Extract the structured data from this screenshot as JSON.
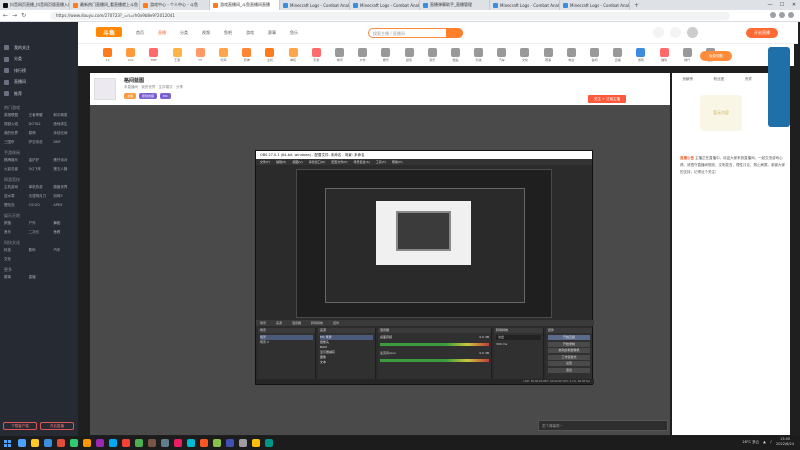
{
  "browser": {
    "tabs": [
      {
        "label": "抖音网页直播_抖音网页版直播入口",
        "icon_color": "#111111",
        "active": false
      },
      {
        "label": "最新热门直播间_看直播就上斗鱼",
        "icon_color": "#ff7a1a",
        "active": false
      },
      {
        "label": "游戏中心 - 个人中心 - 斗鱼",
        "icon_color": "#ff7a1a",
        "active": false
      },
      {
        "label": "游戏直播间_斗鱼直播间直播",
        "icon_color": "#ff7a1a",
        "active": true
      },
      {
        "label": "Minecraft Logs - Combat Analysis",
        "icon_color": "#3c8dde",
        "active": false
      },
      {
        "label": "Minecraft Logs - Combat Analysis",
        "icon_color": "#3c8dde",
        "active": false
      },
      {
        "label": "直播弹幕助手_直播管理",
        "icon_color": "#3c8dde",
        "active": false
      },
      {
        "label": "Minecraft Logs - Combat Analysis",
        "icon_color": "#3c8dde",
        "active": false
      },
      {
        "label": "Minecraft Logs - Combat Analysis",
        "icon_color": "#3c8dde",
        "active": false
      }
    ],
    "new_tab": "+",
    "window_controls": {
      "minimize": "—",
      "maximize": "☐",
      "close": "✕"
    },
    "nav": {
      "back": "←",
      "forward": "→",
      "reload": "↻"
    },
    "url": "https://www.douyu.com/270723?_=n=rh0x9b8e9?2012041"
  },
  "sidebar": {
    "items": [
      "我的关注",
      "分类",
      "排行榜",
      "直播间",
      "推荐"
    ],
    "sections": [
      {
        "title": "热门游戏",
        "items": [
          "英雄联盟",
          "王者荣耀",
          "和平精英",
          "穿越火线",
          "DOTA2",
          "绝地求生",
          "我的世界",
          "原神",
          "永劫无间",
          "三国杀",
          "炉石传说",
          "DNF"
        ]
      },
      {
        "title": "手游休闲",
        "items": [
          "棋牌娱乐",
          "金铲铲",
          "蛋仔派对",
          "火影忍者",
          "QQ飞车",
          "第五人格"
        ]
      },
      {
        "title": "网游竞技",
        "items": [
          "主机游戏",
          "单机热游",
          "魔兽世界",
          "逆水寒",
          "天涯明月刀",
          "剑网3",
          "冒险岛",
          "CS:GO",
          "APEX"
        ]
      },
      {
        "title": "娱乐天地",
        "items": [
          "颜值",
          "户外",
          "舞蹈",
          "音乐",
          "二次元",
          "鱼教"
        ]
      },
      {
        "title": "科技文化",
        "items": [
          "科技",
          "数码",
          "汽车",
          "文化"
        ]
      },
      {
        "title": "更多",
        "items": [
          "赛事",
          "直播"
        ]
      }
    ],
    "bottom_buttons": [
      "下载客户端",
      "开启直播"
    ]
  },
  "site_header": {
    "logo": "斗鱼",
    "nav": [
      "首页",
      "直播",
      "分类",
      "视频",
      "鱼吧",
      "游戏",
      "赛事",
      "鱼乐"
    ],
    "search_placeholder": "搜索主播 / 直播间",
    "open_button": "开启直播"
  },
  "category_row": [
    {
      "label": "12",
      "color": "#ff7a1a"
    },
    {
      "label": "LOL",
      "color": "#ff9a3c"
    },
    {
      "label": "DNF",
      "color": "#ff6b6b"
    },
    {
      "label": "王者",
      "color": "#ffb347"
    },
    {
      "label": "CF",
      "color": "#f96"
    },
    {
      "label": "吃鸡",
      "color": "#ffa64d"
    },
    {
      "label": "原神",
      "color": "#ff8533"
    },
    {
      "label": "主机",
      "color": "#ff7a1a"
    },
    {
      "label": "单机",
      "color": "#ffa64d"
    },
    {
      "label": "手游",
      "color": "#ff6b6b"
    },
    {
      "label": "休闲",
      "color": "#999"
    },
    {
      "label": "户外",
      "color": "#999"
    },
    {
      "label": "娱乐",
      "color": "#999"
    },
    {
      "label": "颜值",
      "color": "#999"
    },
    {
      "label": "音乐",
      "color": "#999"
    },
    {
      "label": "舞蹈",
      "color": "#999"
    },
    {
      "label": "科技",
      "color": "#999"
    },
    {
      "label": "汽车",
      "color": "#999"
    },
    {
      "label": "文化",
      "color": "#999"
    },
    {
      "label": "赛事",
      "color": "#999"
    },
    {
      "label": "电台",
      "color": "#999"
    },
    {
      "label": "鱼吧",
      "color": "#999"
    },
    {
      "label": "直播",
      "color": "#999"
    },
    {
      "label": "游戏",
      "color": "#3c8dde"
    },
    {
      "label": "福利",
      "color": "#ff6b6b"
    },
    {
      "label": "排行",
      "color": "#999"
    },
    {
      "label": "更多",
      "color": "#999"
    }
  ],
  "room": {
    "title": "格间蓝图",
    "subtitle": "本直播间 · 我的世界 · 生存模式 · 分享",
    "tags": [
      {
        "label": "主播",
        "color": "#ff9a3c"
      },
      {
        "label": "原创内容",
        "color": "#7b5fd1"
      },
      {
        "label": "MC",
        "color": "#7b5fd1"
      }
    ],
    "subscribe": "关注 + 订阅主播"
  },
  "obs": {
    "title": "OBS 27.0.1 (64-bit, windows) - 配置文件: 未命名 - 场景: 未命名",
    "menu": [
      "文件(F)",
      "编辑(E)",
      "视图(V)",
      "停靠窗口(D)",
      "配置文件(P)",
      "场景集合(S)",
      "工具(T)",
      "帮助(H)"
    ],
    "panel_bar": [
      "场景",
      "来源",
      "混音器",
      "转场特效",
      "控件"
    ],
    "scenes": [
      "场景",
      "场景 2"
    ],
    "sources": [
      "MC 录屏",
      "摄像头",
      "BGM",
      "显示器捕获",
      "图像",
      "文本"
    ],
    "mixer": [
      {
        "name": "桌面音频",
        "db": "0.0 dB"
      },
      {
        "name": "麦克风/Aux",
        "db": "0.0 dB"
      }
    ],
    "transition": {
      "name": "淡出",
      "duration": "300 ms"
    },
    "controls": [
      "开始直播",
      "开始录制",
      "启动虚拟摄像机",
      "工作室模式",
      "设置",
      "退出"
    ],
    "status": "LIVE: 00:00:00   REC: 00:00:00   CPU: 2.1%, 60.00 fps"
  },
  "chat_input_placeholder": "发个弹幕呗~",
  "right_panel": {
    "tabs": [
      "贡献榜",
      "粉丝团",
      "贵宾",
      "主播"
    ],
    "sticker": "暂无内容",
    "notice_title": "直播公告",
    "notice": "主播正在直播中。欢迎大家来到直播间，一起交流游戏心得。请遵守直播间规则，文明发言，理性讨论，禁止刷屏。谢谢大家的支持，记得点个关注！",
    "ad_button": "免费领取"
  },
  "taskbar": {
    "apps": [
      "#4aa3ff",
      "#ffca28",
      "#3c8dde",
      "#e04d3a",
      "#2ecc71",
      "#ff9800",
      "#9c27b0",
      "#03a9f4",
      "#f44336",
      "#4caf50",
      "#795548",
      "#607d8b",
      "#e91e63",
      "#00bcd4",
      "#ff5722",
      "#8bc34a",
      "#3f51b5",
      "#9e9e9e",
      "#ffc107",
      "#009688"
    ],
    "weather": "28°C 多云",
    "time": "13:00",
    "date": "2022/6/24"
  }
}
